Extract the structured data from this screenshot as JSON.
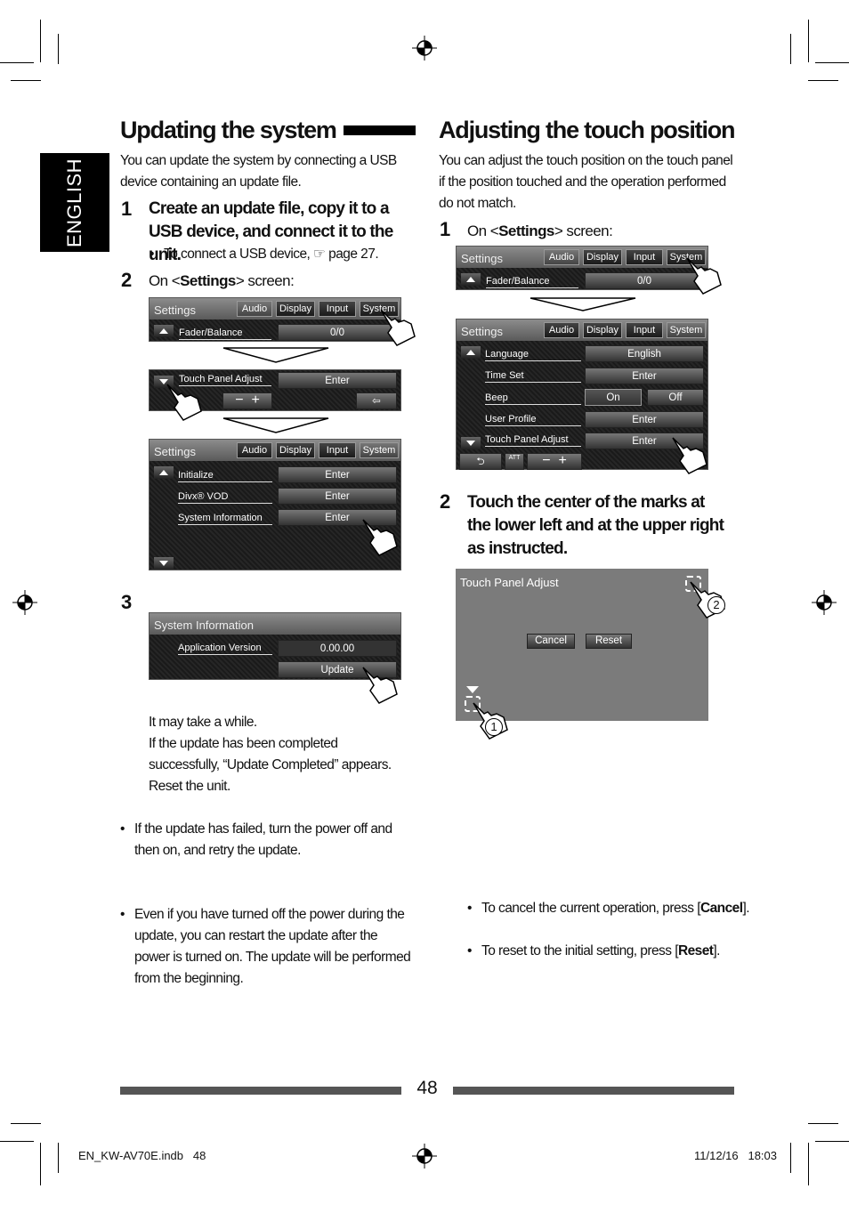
{
  "side_tab": "ENGLISH",
  "left": {
    "title": "Updating the system",
    "intro": "You can update the system by connecting a USB device containing an update file.",
    "step1_num": "1",
    "step1": "Create an update file, copy it to a USB device, and connect it to the unit.",
    "step1_note": "To connect a USB device, ☞ page 27.",
    "step2_num": "2",
    "step2_pre": "On <",
    "step2_bold": "Settings",
    "step2_post": "> screen:",
    "step3_num": "3",
    "after1": "It may take a while.",
    "after2": "If the update has been completed successfully, “Update Completed” appears. Reset the unit.",
    "notes": [
      "If the update has failed, turn the power off and then on, and retry the update.",
      "Even if you have turned off the power during the update, you can restart the update after the power is turned on. The update will be performed from the beginning."
    ]
  },
  "right": {
    "title": "Adjusting the touch position",
    "intro": "You can adjust the touch position on the touch panel if the position touched and the operation performed do not match.",
    "step1_num": "1",
    "step1_pre": "On <",
    "step1_bold": "Settings",
    "step1_post": "> screen:",
    "step2_num": "2",
    "step2": "Touch the center of the marks at the lower left and at the upper right as instructed.",
    "notes": [
      {
        "pre": "To cancel the current operation, press [",
        "bold": "Cancel",
        "post": "]."
      },
      {
        "pre": "To reset to the initial setting, press [",
        "bold": "Reset",
        "post": "]."
      }
    ]
  },
  "screens": {
    "settings_title": "Settings",
    "tabs": [
      "Audio",
      "Display",
      "Input",
      "System"
    ],
    "fader": "Fader/Balance",
    "fader_val": "0/0",
    "tpa": "Touch Panel Adjust",
    "enter": "Enter",
    "system_rows": [
      "Initialize",
      "Divx® VOD",
      "System Information"
    ],
    "rows2": [
      "Language",
      "Time Set",
      "Beep",
      "User Profile",
      "Touch Panel Adjust"
    ],
    "language_val": "English",
    "on": "On",
    "off": "Off",
    "att": "ATT",
    "sysinfo_title": "System Information",
    "app_version": "Application Version",
    "version_val": "0.00.00",
    "update": "Update",
    "tp_title": "Touch Panel Adjust",
    "cancel": "Cancel",
    "reset": "Reset",
    "mark1": "1",
    "mark2": "2"
  },
  "page_number": "48",
  "footer": {
    "file": "EN_KW-AV70E.indb   48",
    "date": "11/12/16   18:03"
  }
}
